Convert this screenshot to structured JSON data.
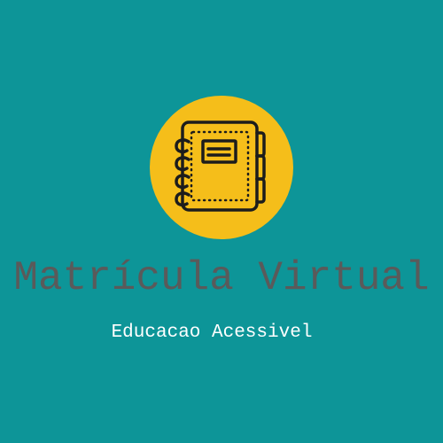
{
  "logo": {
    "icon": "notebook-icon",
    "circle_color": "#f5be1a",
    "line_color": "#1c1c1c"
  },
  "title": "Matrícula Virtual",
  "subtitle": "Educacao Acessivel",
  "colors": {
    "background": "#0d9598",
    "title": "#5a5a5a",
    "subtitle": "#ffffff"
  }
}
